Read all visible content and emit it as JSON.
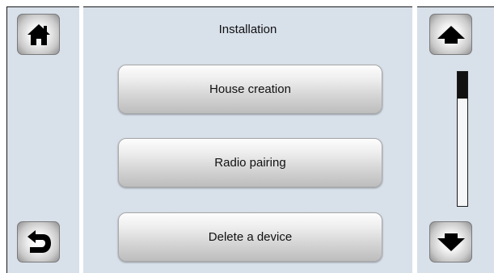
{
  "screen": {
    "title": "Installation"
  },
  "menu": {
    "items": [
      {
        "label": "House creation"
      },
      {
        "label": "Radio pairing"
      },
      {
        "label": "Delete a device"
      }
    ]
  },
  "nav": {
    "home_icon": "home-icon",
    "back_icon": "back-arrow-icon",
    "scroll_up_icon": "arrow-up-icon",
    "scroll_down_icon": "arrow-down-icon"
  },
  "scrollbar": {
    "position_fraction": 0.0,
    "visible_fraction": 0.2
  },
  "colors": {
    "panel_background": "#d8e0ea",
    "button_text": "#111111",
    "icon_color": "#000000"
  }
}
